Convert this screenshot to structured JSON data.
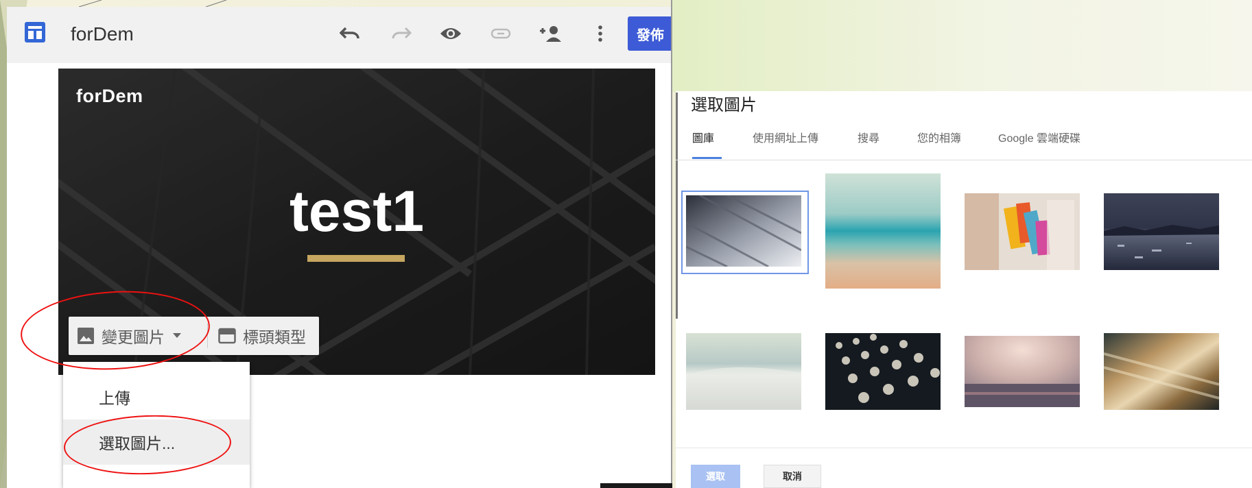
{
  "editor": {
    "site_name": "forDem",
    "toolbar": {
      "undo_icon": "undo-icon",
      "redo_icon": "redo-icon",
      "preview_icon": "eye-icon",
      "link_icon": "link-icon",
      "share_icon": "add-person-icon",
      "more_icon": "more-vert-icon",
      "publish_label": "發佈"
    },
    "header": {
      "site_title": "forDem",
      "page_title": "test1",
      "accent_color": "#c6a660",
      "change_image_label": "變更圖片",
      "header_type_label": "標頭類型"
    },
    "image_menu": {
      "items": [
        {
          "label": "上傳"
        },
        {
          "label": "選取圖片..."
        }
      ]
    }
  },
  "dialog": {
    "title": "選取圖片",
    "tabs": [
      {
        "label": "圖庫",
        "active": true
      },
      {
        "label": "使用網址上傳"
      },
      {
        "label": "搜尋"
      },
      {
        "label": "您的相簿"
      },
      {
        "label": "Google 雲端硬碟"
      }
    ],
    "gallery": [
      {
        "subject": "architecture-diagonal",
        "selected": true
      },
      {
        "subject": "ocean-blur"
      },
      {
        "subject": "sticky-notes"
      },
      {
        "subject": "glacier-lake"
      },
      {
        "subject": "snow-shore"
      },
      {
        "subject": "typewriter-keys"
      },
      {
        "subject": "sunset-horizon"
      },
      {
        "subject": "motion-blur"
      }
    ],
    "select_label": "選取",
    "cancel_label": "取消"
  },
  "colors": {
    "brand_blue": "#3d5bd6",
    "annotation_red": "#e11111"
  }
}
